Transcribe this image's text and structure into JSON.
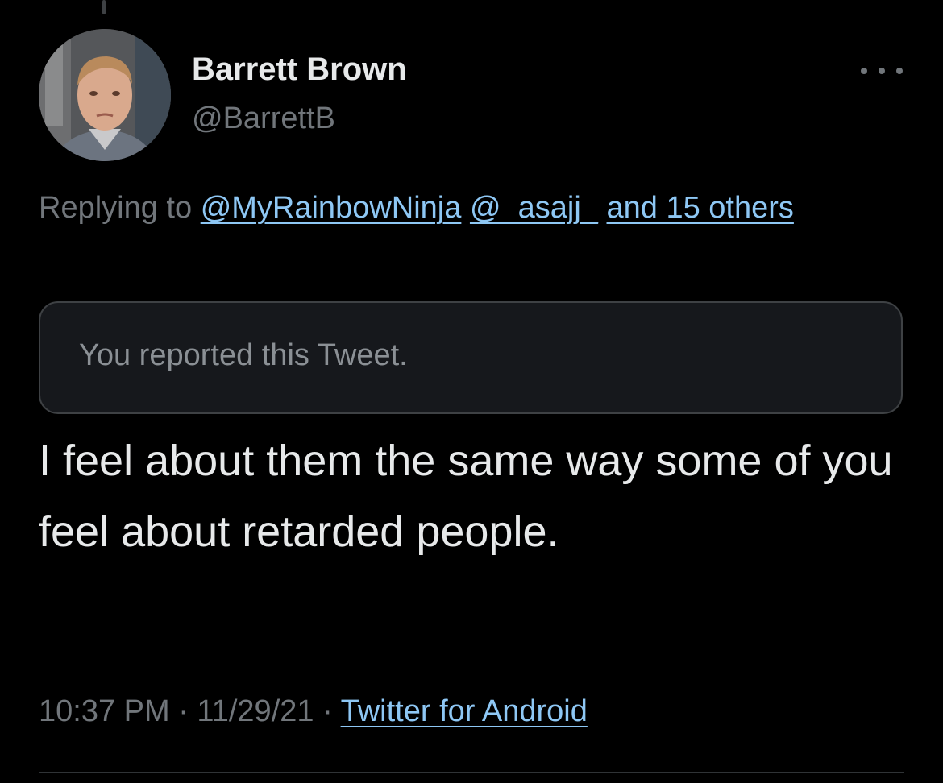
{
  "tweet": {
    "author": {
      "display_name": "Barrett Brown",
      "handle": "@BarrettB",
      "avatar_icon": "profile-photo"
    },
    "more_icon": "ellipsis-icon",
    "replying_to": {
      "prefix": "Replying to",
      "mention_1": "@MyRainbowNinja",
      "mention_2": "@_asajj_",
      "others": "and 15 others"
    },
    "notice": "You reported this Tweet.",
    "text": "I feel about them the same way some of you feel about retarded people.",
    "timestamp": "10:37 PM · 11/29/21 ·",
    "source": "Twitter for Android"
  },
  "colors": {
    "background": "#000000",
    "primary_text": "#e7e9ea",
    "secondary_text": "#71767b",
    "link": "#8ec7f4",
    "notice_background": "#16181c",
    "border": "#3e4144"
  }
}
